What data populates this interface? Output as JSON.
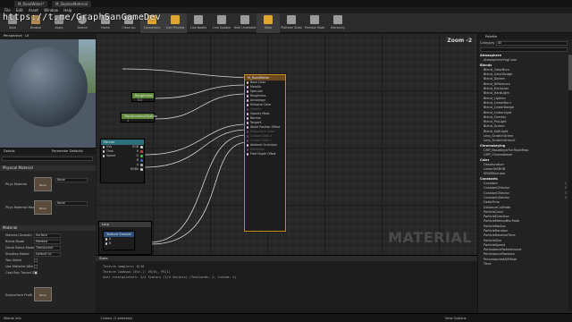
{
  "window": {
    "tabs": [
      "M_RoadWater*",
      "M_SkyboxMaterial"
    ]
  },
  "menu": [
    "File",
    "Edit",
    "Asset",
    "Window",
    "Help"
  ],
  "watermark": "https://t.me/GraphSanGameDev",
  "toolbar": [
    {
      "label": "Save",
      "icon": "save-icon",
      "color": "#8f8f8f"
    },
    {
      "label": "Browse",
      "icon": "browse-icon",
      "color": "#b08a4e"
    },
    {
      "label": "Apply",
      "icon": "apply-icon",
      "color": "#8f8f8f"
    },
    {
      "label": "Search",
      "icon": "search-icon",
      "color": "#9a9a9a"
    },
    {
      "label": "Home",
      "icon": "home-icon",
      "color": "#9a9a9a"
    },
    {
      "label": "Clean Up",
      "icon": "clean-up-icon",
      "color": "#9a9a9a"
    },
    {
      "label": "Connectors",
      "icon": "connectors-icon",
      "color": "#e0a530"
    },
    {
      "label": "Live Preview",
      "icon": "live-preview-icon",
      "color": "#e0a530"
    },
    {
      "label": "Live Nodes",
      "icon": "live-nodes-icon",
      "color": "#9a9a9a"
    },
    {
      "label": "Live Update",
      "icon": "live-update-icon",
      "color": "#9a9a9a"
    },
    {
      "label": "Hide Unrelated",
      "icon": "hide-unrelated-icon",
      "color": "#9a9a9a"
    },
    {
      "label": "Stats",
      "icon": "stats-icon",
      "color": "#e0a530"
    },
    {
      "label": "Platform Stats",
      "icon": "platform-stats-icon",
      "color": "#9a9a9a"
    },
    {
      "label": "Preview State",
      "icon": "preview-state-icon",
      "color": "#9a9a9a"
    },
    {
      "label": "Hierarchy",
      "icon": "hierarchy-icon",
      "color": "#9a9a9a"
    }
  ],
  "viewport": {
    "tab": "Perspective",
    "lit": "Lit"
  },
  "details": {
    "tabs": [
      "Details",
      "Parameter Defaults"
    ],
    "sections": {
      "physical": "Physical Material",
      "material": "Material"
    },
    "props": {
      "phys_mat": "Phys Material",
      "phys_mat_mask": "Phys Material Mask",
      "domain_label": "Material Domain",
      "domain_val": "Surface",
      "blend_label": "Blend Mode",
      "blend_val": "Masked",
      "decal_label": "Decal Blend Mode",
      "decal_val": "Translucent",
      "shading_label": "Shading Model",
      "shading_val": "Default Lit",
      "two_sided": "Two Sided",
      "use_mat_attr": "Use Material Attri",
      "cast_ray": "Cast Ray Traced S",
      "subsurface": "Subsurface Profil",
      "none1": "None",
      "none2": "None",
      "none3": "None"
    }
  },
  "graph": {
    "zoom": "Zoom -2",
    "watermark": "MATERIAL",
    "nodes": {
      "main_title": "M_RoadWater",
      "main_pins": [
        "Base Color",
        "Metallic",
        "Specular",
        "Roughness",
        "Anisotropy",
        "Emissive Color",
        "Opacity",
        "Opacity Mask",
        "Normal",
        "Tangent",
        "World Position Offset",
        "Subsurface Color",
        "Custom Data 0",
        "Custom Data 1",
        "Ambient Occlusion",
        "Refraction",
        "Pixel Depth Offset",
        "Shading Model"
      ],
      "roughness_title": "Roughness",
      "roughness_val": "0.5",
      "translucency_title": "TranslucencyOpacity",
      "translucency_val": "1",
      "panner_title": "Panner",
      "panner_pins": [
        "UVs",
        "Time",
        "Speed"
      ],
      "panner_outputs": [
        "RGB",
        "R",
        "G",
        "B",
        "A",
        "RGBA"
      ],
      "texture_title": "Texture Sample",
      "lerp_title": "Lerp",
      "lerp_pins": [
        "A",
        "B",
        "Alpha"
      ]
    }
  },
  "stats": {
    "tab": "Stats",
    "lines": [
      "Texture samplers: 8/16",
      "Texture Lookups (Est.): VS(0), PS(1)",
      "User interpolators: 4/4 Scalars (1/4 Vectors) (TexCoords: 2, Custom: 2)"
    ]
  },
  "palette": {
    "tab": "Palette",
    "category_label": "Category",
    "category_val": "All",
    "items": [
      {
        "t": "Atmosphere",
        "cat": true
      },
      {
        "t": "AtmosphericFogColor"
      },
      {
        "t": "Blends",
        "cat": true
      },
      {
        "t": "Blend_ColorBurn"
      },
      {
        "t": "Blend_ColorDodge"
      },
      {
        "t": "Blend_Darken"
      },
      {
        "t": "Blend_Difference"
      },
      {
        "t": "Blend_Exclusion"
      },
      {
        "t": "Blend_HardLight"
      },
      {
        "t": "Blend_Lighten"
      },
      {
        "t": "Blend_LinearBurn"
      },
      {
        "t": "Blend_LinearDodge"
      },
      {
        "t": "Blend_LinearLight"
      },
      {
        "t": "Blend_Overlay"
      },
      {
        "t": "Blend_PinLight"
      },
      {
        "t": "Blend_Screen"
      },
      {
        "t": "Blend_SoftLight"
      },
      {
        "t": "Lerp_ScratchGrime"
      },
      {
        "t": "Lerp_ScratchGrime2"
      },
      {
        "t": "Chromakeying",
        "cat": true
      },
      {
        "t": "CMP_BaseKeyerForTriplePass"
      },
      {
        "t": "CMP_Chromakeyer"
      },
      {
        "t": "Color",
        "cat": true
      },
      {
        "t": "Desaturation"
      },
      {
        "t": "LinearToSRGB"
      },
      {
        "t": "SRGBToLinear"
      },
      {
        "t": "Constants",
        "cat": true
      },
      {
        "t": "Constant",
        "hk": "1"
      },
      {
        "t": "Constant2Vector",
        "hk": "2"
      },
      {
        "t": "Constant3Vector",
        "hk": "3"
      },
      {
        "t": "Constant4Vector",
        "hk": "4"
      },
      {
        "t": "DeltaTime"
      },
      {
        "t": "DistanceCullFade"
      },
      {
        "t": "ParticleColor"
      },
      {
        "t": "ParticleDirection"
      },
      {
        "t": "ParticleMotionBlurFade"
      },
      {
        "t": "ParticleRadius"
      },
      {
        "t": "ParticleRandom"
      },
      {
        "t": "ParticleRelativeTime"
      },
      {
        "t": "ParticleSize"
      },
      {
        "t": "ParticleSpeed"
      },
      {
        "t": "PerInstanceFadeAmount"
      },
      {
        "t": "PerInstanceRandom"
      },
      {
        "t": "PrecomputedAOMask"
      },
      {
        "t": "Time"
      }
    ]
  },
  "bottom": {
    "left_label": "Mobile info",
    "selection": "1 items (1 selected)",
    "view_options": "View Options"
  }
}
